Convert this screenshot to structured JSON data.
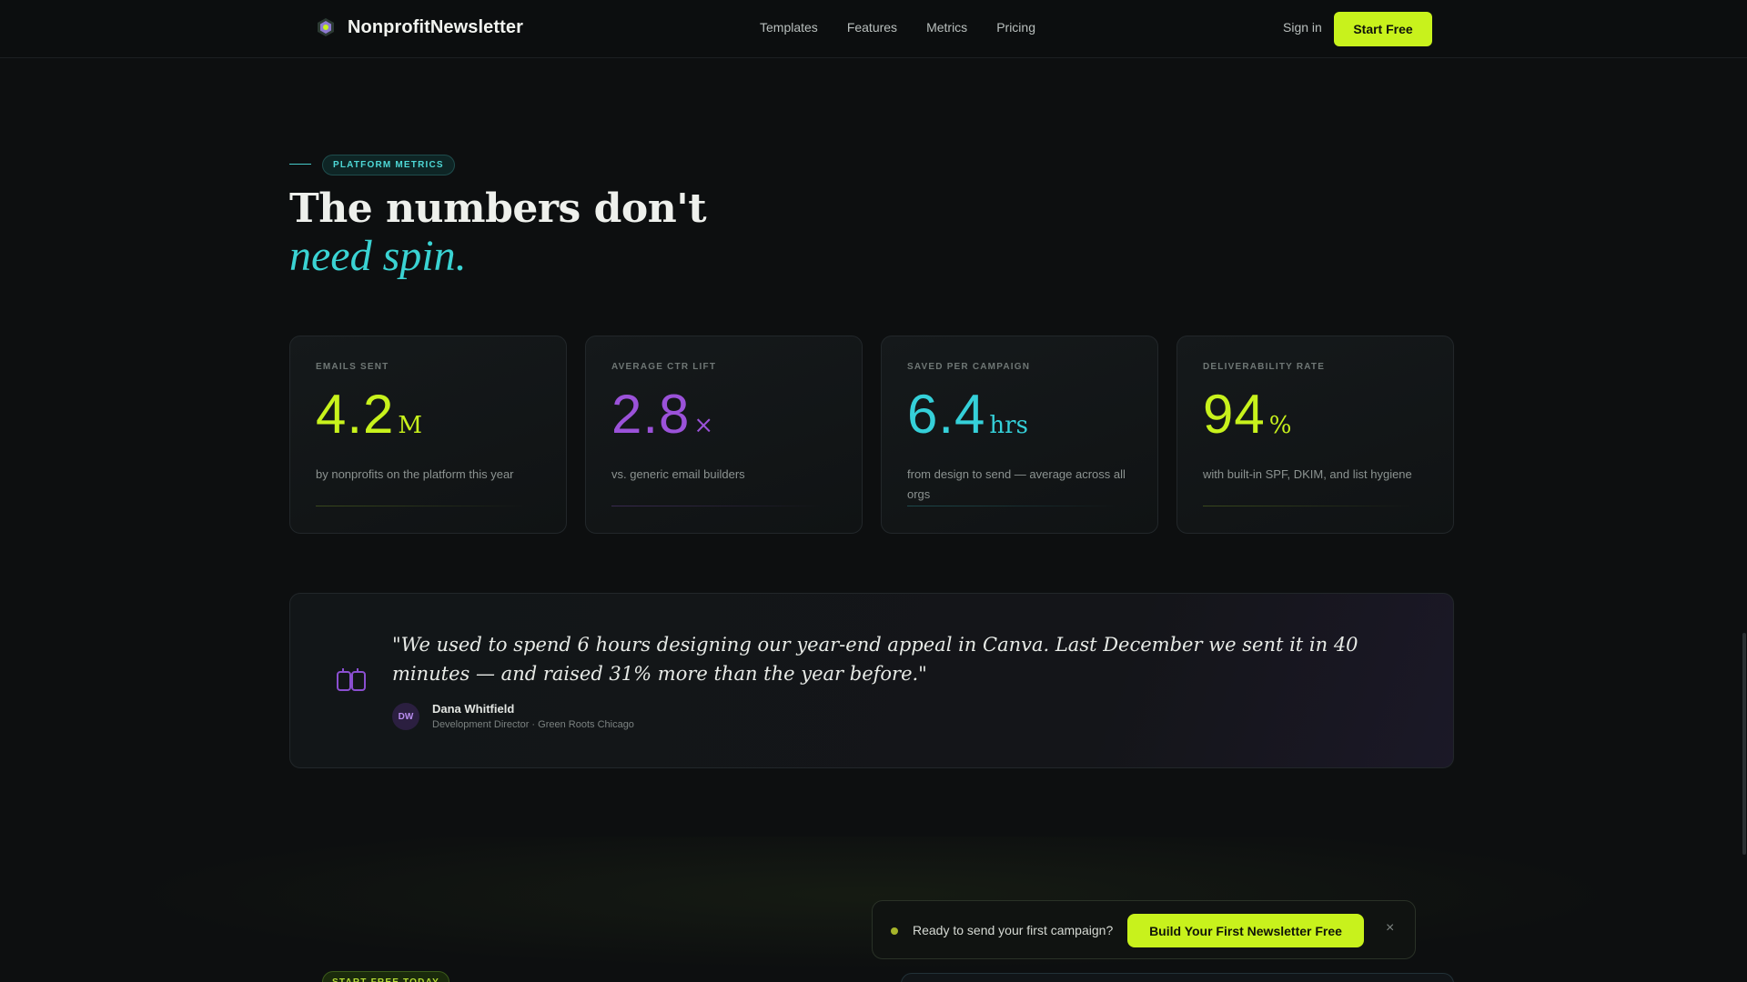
{
  "nav": {
    "brand": "NonprofitNewsletter",
    "links": [
      "Templates",
      "Features",
      "Metrics",
      "Pricing"
    ],
    "signin": "Sign in",
    "cta": "Start Free"
  },
  "hero": {
    "eyebrow": "PLATFORM METRICS",
    "title_line1": "The numbers don't",
    "title_line2": "need spin."
  },
  "metrics": [
    {
      "label": "EMAILS SENT",
      "value": "4.2",
      "unit": "M",
      "desc": "by nonprofits on the platform this year",
      "color": "#c8f21c"
    },
    {
      "label": "AVERAGE CTR LIFT",
      "value": "2.8",
      "unit": "×",
      "desc": "vs. generic email builders",
      "color": "#9b52d9"
    },
    {
      "label": "SAVED PER CAMPAIGN",
      "value": "6.4",
      "unit": "hrs",
      "desc": "from design to send — average across all orgs",
      "color": "#35d0d9"
    },
    {
      "label": "DELIVERABILITY RATE",
      "value": "94",
      "unit": "%",
      "desc": "with built-in SPF, DKIM, and list hygiene",
      "color": "#c8f21c"
    }
  ],
  "testimonial": {
    "quote": "\"We used to spend 6 hours designing our year-end appeal in Canva. Last December we sent it in 40 minutes — and raised 31% more than the year before.\"",
    "initials": "DW",
    "name": "Dana Whitfield",
    "role": "Development Director · Green Roots Chicago"
  },
  "cta_strip": {
    "text": "Ready to send your first campaign?",
    "button": "Build Your First Newsletter Free",
    "close": "×"
  },
  "bottom_badge": "START FREE TODAY",
  "colors": {
    "accent_lime": "#c8f21c",
    "accent_teal": "#3ad3d3",
    "accent_purple": "#9b52d9",
    "background": "#0d0f10"
  }
}
